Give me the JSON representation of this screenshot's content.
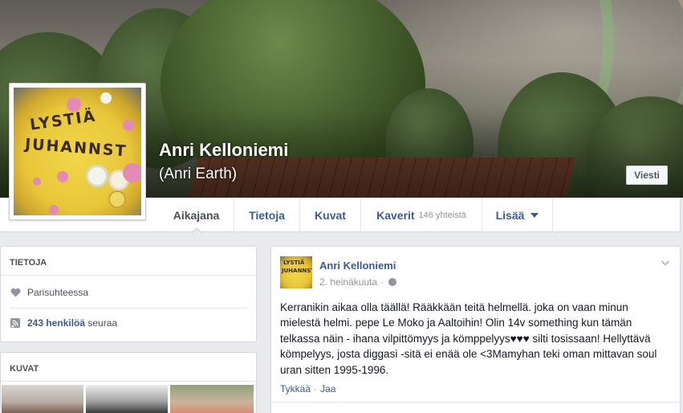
{
  "profile": {
    "name": "Anri Kelloniemi",
    "alt_name": "(Anri Earth)",
    "message_button": "Viesti",
    "cake_line1": "LYSTIÄ",
    "cake_line2": "JUHANNST"
  },
  "tabs": [
    {
      "label": "Aikajana",
      "active": true
    },
    {
      "label": "Tietoja"
    },
    {
      "label": "Kuvat"
    },
    {
      "label": "Kaverit",
      "count": "146 yhteistä"
    },
    {
      "label": "Lisää"
    }
  ],
  "about": {
    "title": "TIETOJA",
    "relationship": "Parisuhteessa",
    "followers_bold": "243 henkilöä",
    "followers_rest": " seuraa"
  },
  "photos": {
    "title": "KUVAT"
  },
  "post": {
    "author": "Anri Kelloniemi",
    "date": "2. heinäkuuta",
    "meta_sep": "·",
    "body": "Kerranikin aikaa olla täällä! Rääkkään teitä helmellä. joka on vaan minun mielestä helmi. pepe Le Moko ja Aaltoihin! Olin 14v something kun tämän telkassa näin - ihana vilpittömyys ja kömppelyys♥♥♥ silti tosissaan! Hellyttävä kömpelyys, josta diggasi -sitä ei enää ole <3Mamyhan teki oman mittavan soul uran sitten 1995-1996.",
    "like": "Tykkää",
    "dot": "·",
    "share": "Jaa"
  },
  "colors": {
    "link": "#3b5998",
    "background": "#e9eaed",
    "muted": "#90949c"
  }
}
